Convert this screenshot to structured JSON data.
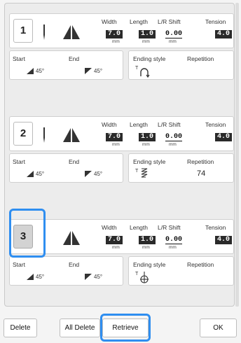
{
  "columns": {
    "width_label": "Width",
    "length_label": "Length",
    "shift_label": "L/R Shift",
    "tension_label": "Tension",
    "unit": "mm"
  },
  "sub_labels": {
    "start": "Start",
    "end": "End",
    "ending_style": "Ending style",
    "repetition": "Repetition"
  },
  "entries": [
    {
      "number": "1",
      "width": "7.0",
      "length": "1.0",
      "shift": "0.00",
      "tension": "4.0",
      "start_angle": "45°",
      "end_angle": "45°",
      "ending_style_icon": "tie-off-loop-icon",
      "repetition": ""
    },
    {
      "number": "2",
      "width": "7.0",
      "length": "1.0",
      "shift": "0.00",
      "tension": "4.0",
      "start_angle": "45°",
      "end_angle": "45°",
      "ending_style_icon": "repeat-zigzag-icon",
      "repetition": "74"
    },
    {
      "number": "3",
      "width": "7.0",
      "length": "1.0",
      "shift": "0.00",
      "tension": "4.0",
      "start_angle": "45°",
      "end_angle": "45°",
      "ending_style_icon": "needle-stop-icon",
      "repetition": ""
    }
  ],
  "buttons": {
    "delete": "Delete",
    "all_delete": "All Delete",
    "retrieve": "Retrieve",
    "ok": "OK"
  },
  "colors": {
    "highlight": "#2f8ef0",
    "selected_number_bg": "#d3d3d3"
  }
}
